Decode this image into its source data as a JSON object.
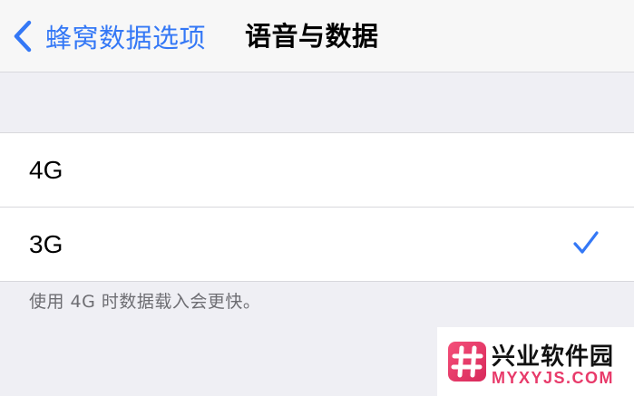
{
  "navbar": {
    "back_label": "蜂窝数据选项",
    "title": "语音与数据"
  },
  "options": [
    {
      "label": "4G",
      "selected": false
    },
    {
      "label": "3G",
      "selected": true
    }
  ],
  "footer_note": "使用 4G 时数据载入会更快。",
  "colors": {
    "accent": "#3478f6",
    "background": "#efeff4",
    "cell": "#ffffff",
    "watermark_pink": "#e83a6a"
  },
  "icons": {
    "back": "chevron-left-icon",
    "selected": "checkmark-icon",
    "watermark_logo": "hash-logo-icon"
  },
  "watermark": {
    "title": "兴业软件园",
    "subtitle": "MYXYJS.COM"
  }
}
